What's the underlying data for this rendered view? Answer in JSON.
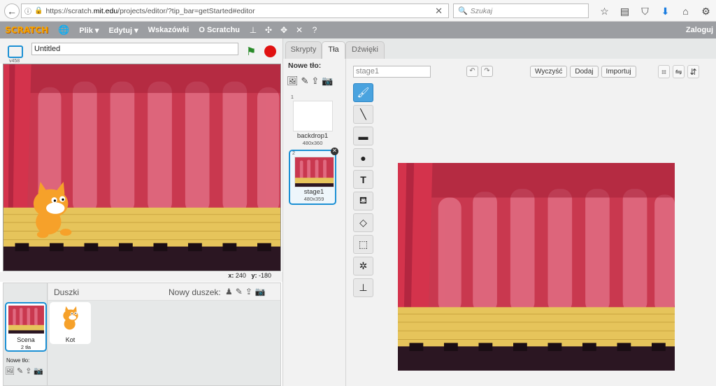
{
  "browser": {
    "url_prefix": "https://scratch.",
    "url_domain": "mit.edu",
    "url_suffix": "/projects/editor/?tip_bar=getStarted#editor",
    "search_placeholder": "Szukaj"
  },
  "menu": {
    "logo": "SCRATCH",
    "file": "Plik ▾",
    "edit": "Edytuj ▾",
    "tips": "Wskazówki",
    "about": "O Scratchu",
    "login": "Zaloguj"
  },
  "stage": {
    "project_title": "Untitled",
    "version": "v458",
    "x_label": "x:",
    "x_value": "240",
    "y_label": "y:",
    "y_value": "-180"
  },
  "sprites_panel": {
    "title": "Duszki",
    "new_sprite": "Nowy duszek:",
    "stage_name": "Scena",
    "stage_backdrops": "2 tła",
    "new_backdrop": "Nowe tło:",
    "sprites": [
      {
        "name": "Kot"
      }
    ]
  },
  "tabs": {
    "scripts": "Skrypty",
    "backdrops": "Tła",
    "sounds": "Dźwięki"
  },
  "backdrops": {
    "new_label": "Nowe tło:",
    "items": [
      {
        "num": "1",
        "name": "backdrop1",
        "size": "480x360"
      },
      {
        "num": "2",
        "name": "stage1",
        "size": "480x359"
      }
    ]
  },
  "editor": {
    "costume_name": "stage1",
    "clear": "Wyczyść",
    "add": "Dodaj",
    "import": "Importuj"
  },
  "colors": {
    "accent": "#1b90d4",
    "menubar": "#9c9ea2",
    "curtain": "#c9384f",
    "floor": "#e8c560"
  }
}
